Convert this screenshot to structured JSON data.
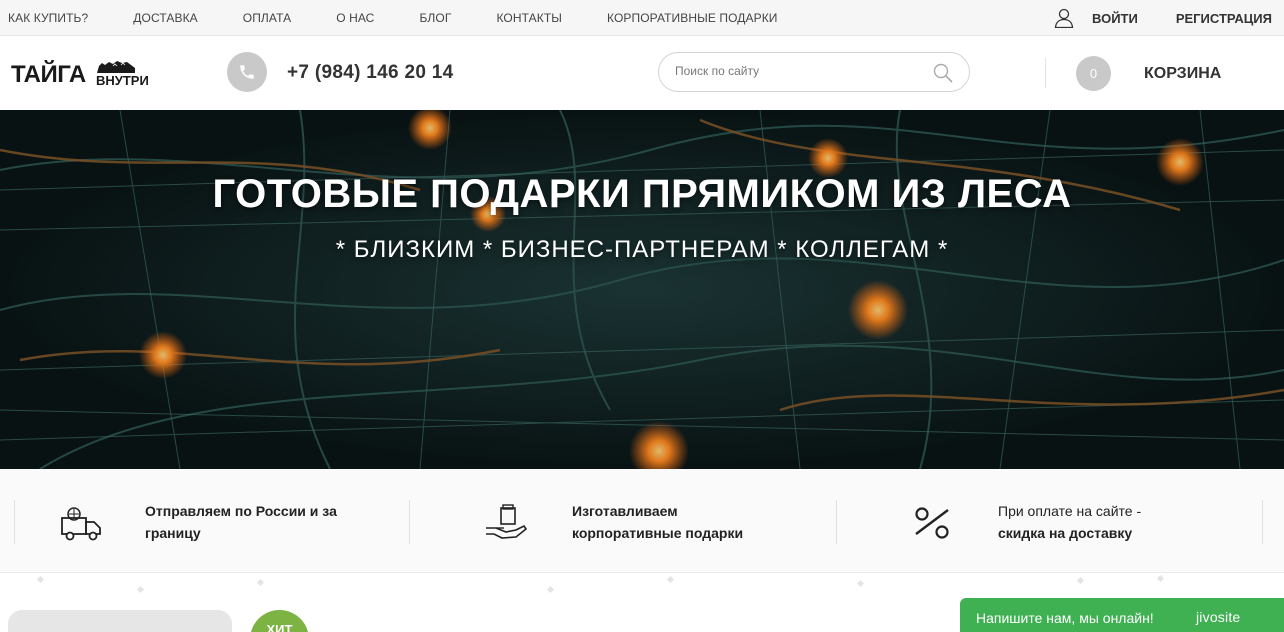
{
  "topnav": {
    "items": [
      "КАК КУПИТЬ?",
      "ДОСТАВКА",
      "ОПЛАТА",
      "О НАС",
      "БЛОГ",
      "КОНТАКТЫ",
      "КОРПОРАТИВНЫЕ ПОДАРКИ"
    ],
    "login": "ВОЙТИ",
    "register": "РЕГИСТРАЦИЯ"
  },
  "header": {
    "logo_main": "ТАЙГА",
    "logo_sub": "ВНУТРИ",
    "phone": "+7 (984) 146 20 14",
    "search_placeholder": "Поиск по сайту",
    "cart_count": "0",
    "cart_label": "КОРЗИНА"
  },
  "hero": {
    "title": "ГОТОВЫЕ ПОДАРКИ ПРЯМИКОМ ИЗ ЛЕСА",
    "subtitle": "* БЛИЗКИМ * БИЗНЕС-ПАРТНЕРАМ * КОЛЛЕГАМ *"
  },
  "features": [
    {
      "icon": "delivery-truck-icon",
      "line1": "Отправляем по России и за",
      "line2": "границу"
    },
    {
      "icon": "gift-hand-icon",
      "line1": "Изготавливаем",
      "line2": "корпоративные подарки"
    },
    {
      "icon": "percent-icon",
      "line1": "При оплате на сайте -",
      "line2": "скидка на доставку"
    }
  ],
  "badge": {
    "hit": "ХИТ"
  },
  "chat": {
    "message": "Напишите нам, мы онлайн!",
    "brand": "jivosite"
  },
  "colors": {
    "accent_green": "#7cb342",
    "chat_green": "#3fb152",
    "grey_circle": "#c9c9c9"
  }
}
